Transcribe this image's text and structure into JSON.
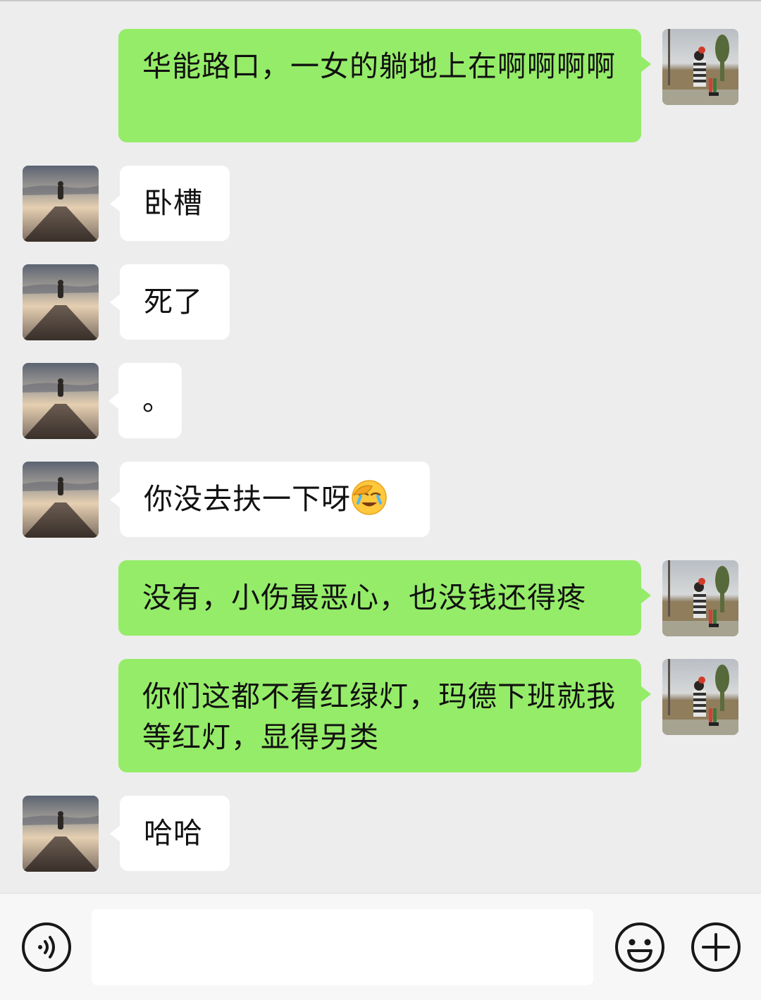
{
  "messages": [
    {
      "side": "out",
      "text": "华能路口，一女的躺地上在啊啊啊啊"
    },
    {
      "side": "in",
      "text": "卧槽"
    },
    {
      "side": "in",
      "text": "死了"
    },
    {
      "side": "in",
      "text": "。"
    },
    {
      "side": "in",
      "text": "你没去扶一下呀",
      "emoji": "facepalm-emoji"
    },
    {
      "side": "out",
      "text": "没有，小伤最恶心，也没钱还得疼"
    },
    {
      "side": "out",
      "text": "你们这都不看红绿灯，玛德下班就我等红灯，显得另类"
    },
    {
      "side": "in",
      "text": "哈哈"
    }
  ],
  "input_bar": {
    "message_value": "",
    "icons": [
      "voice-icon",
      "emoji-icon",
      "plus-icon"
    ]
  },
  "colors": {
    "background": "#ededed",
    "outgoing_bubble": "#95ec69",
    "incoming_bubble": "#ffffff",
    "input_bar": "#f7f7f7"
  }
}
